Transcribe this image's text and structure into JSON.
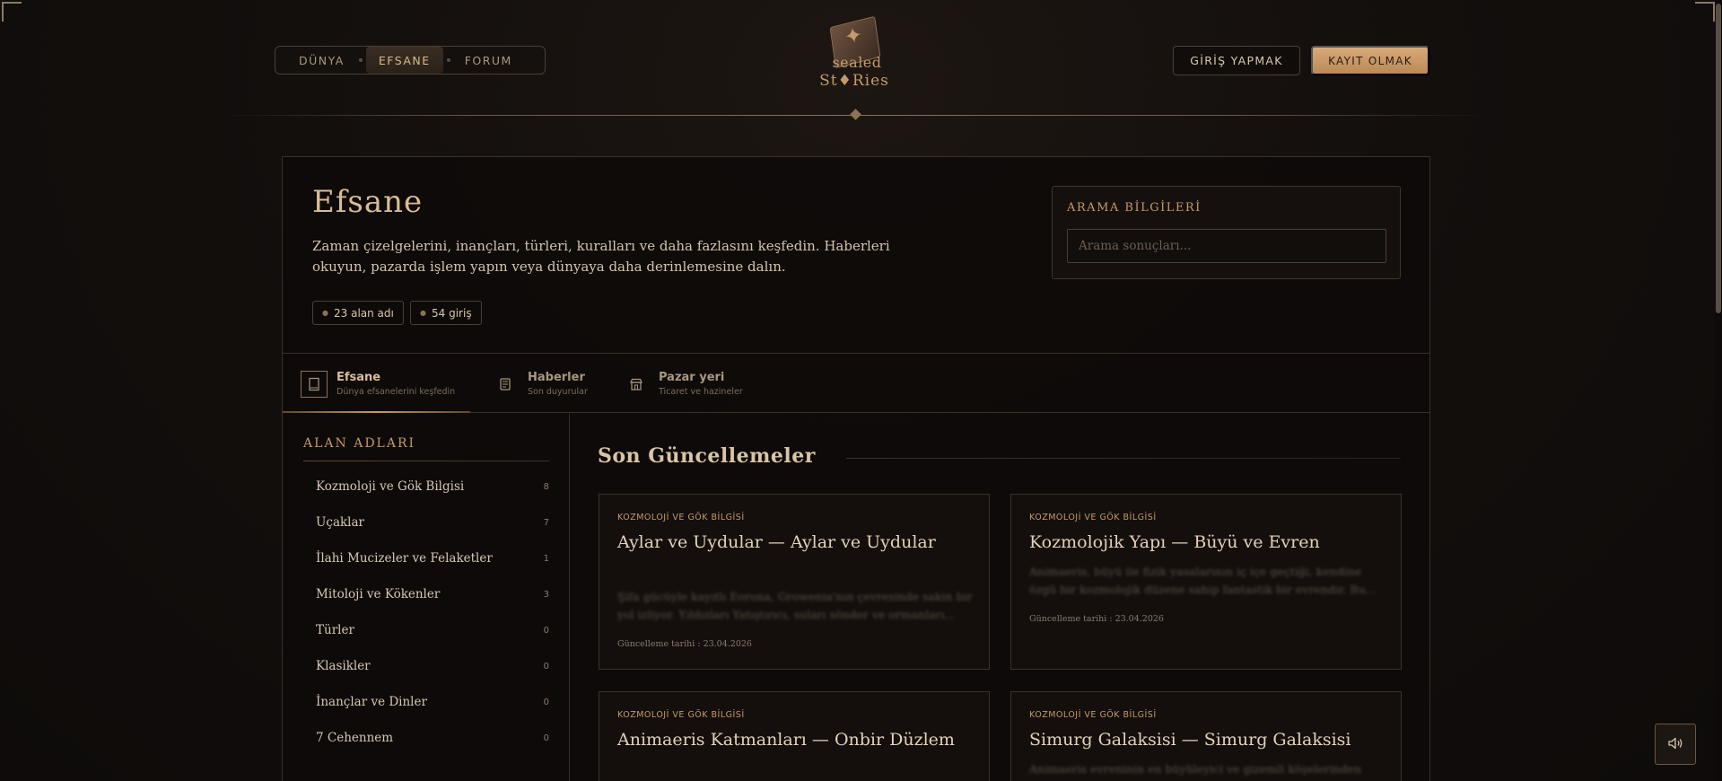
{
  "nav": {
    "items": [
      {
        "label": "DÜNYA",
        "active": false
      },
      {
        "label": "EFSANE",
        "active": true
      },
      {
        "label": "FORUM",
        "active": false
      }
    ]
  },
  "logo": {
    "line1": "sealed",
    "line2": "St♦Ries"
  },
  "auth": {
    "login_label": "GİRİŞ YAPMAK",
    "register_label": "KAYIT OLMAK"
  },
  "hero": {
    "title": "Efsane",
    "description": "Zaman çizelgelerini, inançları, türleri, kuralları ve daha fazlasını keşfedin. Haberleri okuyun, pazarda işlem yapın veya dünyaya daha derinlemesine dalın.",
    "badges": [
      {
        "count": "23",
        "label": "alan adı"
      },
      {
        "count": "54",
        "label": "giriş"
      }
    ]
  },
  "search": {
    "label": "ARAMA BİLGİLERİ",
    "placeholder": "Arama sonuçları..."
  },
  "tabs": [
    {
      "title": "Efsane",
      "subtitle": "Dünya efsanelerini keşfedin",
      "icon": "book-icon",
      "active": true
    },
    {
      "title": "Haberler",
      "subtitle": "Son duyurular",
      "icon": "newspaper-icon",
      "active": false
    },
    {
      "title": "Pazar yeri",
      "subtitle": "Ticaret ve hazineler",
      "icon": "store-icon",
      "active": false
    }
  ],
  "sidebar": {
    "title": "ALAN ADLARI",
    "items": [
      {
        "name": "Kozmoloji ve Gök Bilgisi",
        "count": "8"
      },
      {
        "name": "Uçaklar",
        "count": "7"
      },
      {
        "name": "İlahi Mucizeler ve Felaketler",
        "count": "1"
      },
      {
        "name": "Mitoloji ve Kökenler",
        "count": "3"
      },
      {
        "name": "Türler",
        "count": "0"
      },
      {
        "name": "Klasikler",
        "count": "0"
      },
      {
        "name": "İnançlar ve Dinler",
        "count": "0"
      },
      {
        "name": "7 Cehennem",
        "count": "0"
      }
    ]
  },
  "content": {
    "title": "Son Güncellemeler",
    "cards": [
      {
        "category": "KOZMOLOJİ VE GÖK BİLGİSİ",
        "title": "Aylar ve Uydular — Aylar ve Uydular",
        "excerpt": "Şifa gücüyle kayıtlı Eorona, Growenia'nın çevresinde sakin bir yol izliyor. Yıldızları Yatıştırıcı, suları sönder ve ormanları...",
        "date": "Güncelleme tarihi : 23.04.2026"
      },
      {
        "category": "KOZMOLOJİ VE GÖK BİLGİSİ",
        "title": "Kozmolojik Yapı — Büyü ve Evren",
        "excerpt": "Animaeris, büyü ile fizik yasalarının iç içe geçtiği, kendine özgü bir kozmolojik düzene sahip fantastik bir evrendir. Bu...",
        "date": "Güncelleme tarihi : 23.04.2026"
      },
      {
        "category": "KOZMOLOJİ VE GÖK BİLGİSİ",
        "title": "Animaeris Katmanları — Onbir Düzlem",
        "excerpt": "",
        "date": ""
      },
      {
        "category": "KOZMOLOJİ VE GÖK BİLGİSİ",
        "title": "Simurg Galaksisi — Simurg Galaksisi",
        "excerpt": "Animaeris evreninin en büyüleyici ve gizemli köşelerinden",
        "date": ""
      }
    ]
  },
  "colors": {
    "accent": "#c49a6c",
    "background": "#110d0b",
    "border": "#3a3129"
  }
}
